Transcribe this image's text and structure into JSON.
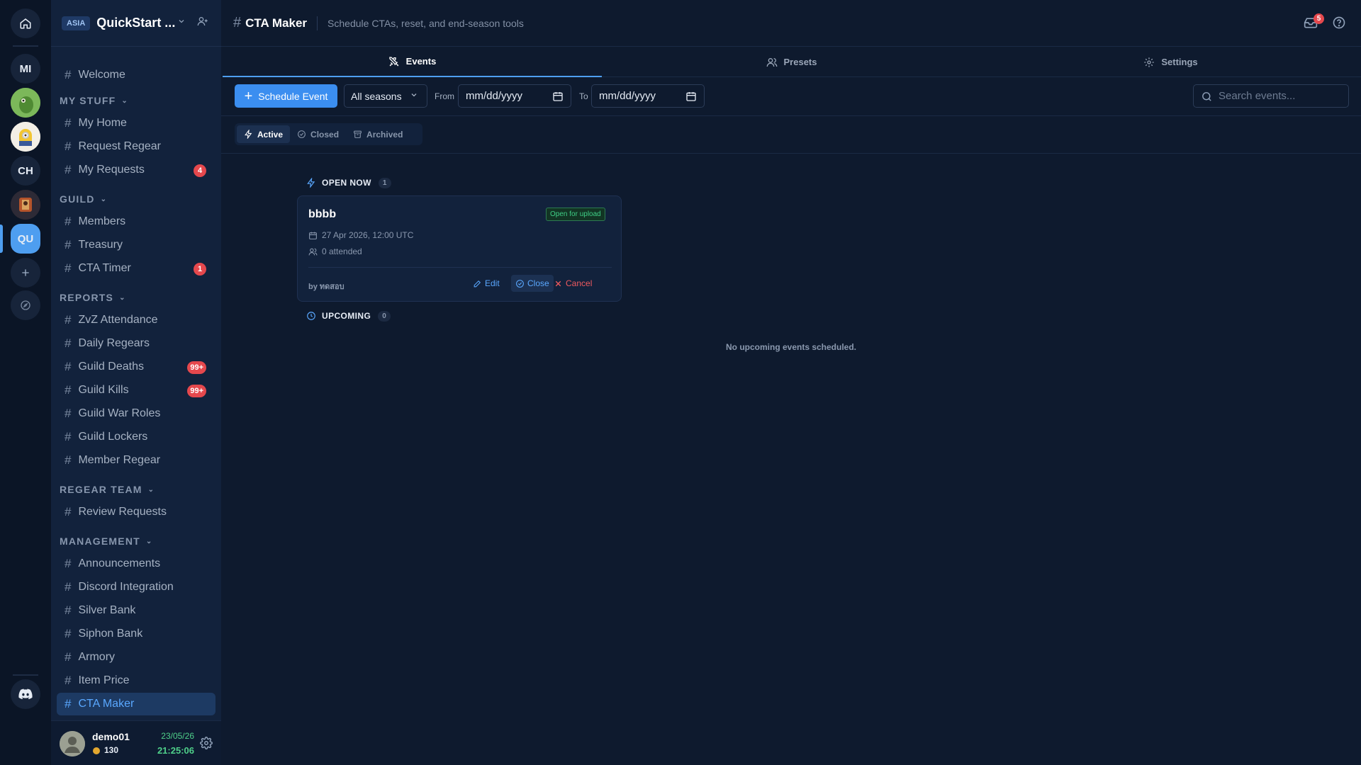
{
  "rail": {
    "items": [
      {
        "label": ""
      },
      {
        "label": "MI"
      },
      {
        "label": ""
      },
      {
        "label": ""
      },
      {
        "label": "CH"
      },
      {
        "label": ""
      },
      {
        "label": "QU"
      }
    ]
  },
  "server": {
    "region": "ASIA",
    "name": "QuickStart ..."
  },
  "sidebar": {
    "welcome": "Welcome",
    "categories": {
      "my_stuff": "MY STUFF",
      "guild": "GUILD",
      "reports": "REPORTS",
      "regear_team": "REGEAR TEAM",
      "management": "MANAGEMENT"
    },
    "my_stuff": [
      {
        "label": "My Home",
        "badge": ""
      },
      {
        "label": "Request Regear",
        "badge": ""
      },
      {
        "label": "My Requests",
        "badge": "4"
      }
    ],
    "guild": [
      {
        "label": "Members",
        "badge": ""
      },
      {
        "label": "Treasury",
        "badge": ""
      },
      {
        "label": "CTA Timer",
        "badge": "1"
      }
    ],
    "reports": [
      {
        "label": "ZvZ Attendance",
        "badge": ""
      },
      {
        "label": "Daily Regears",
        "badge": ""
      },
      {
        "label": "Guild Deaths",
        "badge": "99+"
      },
      {
        "label": "Guild Kills",
        "badge": "99+"
      },
      {
        "label": "Guild War Roles",
        "badge": ""
      },
      {
        "label": "Guild Lockers",
        "badge": ""
      },
      {
        "label": "Member Regear",
        "badge": ""
      }
    ],
    "regear_team": [
      {
        "label": "Review Requests",
        "badge": ""
      }
    ],
    "management": [
      {
        "label": "Announcements",
        "badge": ""
      },
      {
        "label": "Discord Integration",
        "badge": ""
      },
      {
        "label": "Silver Bank",
        "badge": ""
      },
      {
        "label": "Siphon Bank",
        "badge": ""
      },
      {
        "label": "Armory",
        "badge": ""
      },
      {
        "label": "Item Price",
        "badge": ""
      },
      {
        "label": "CTA Maker",
        "badge": ""
      }
    ]
  },
  "user": {
    "name": "demo01",
    "coins": "130",
    "date": "23/05/26",
    "time": "21:25:06"
  },
  "header": {
    "title": "CTA Maker",
    "subtitle": "Schedule CTAs, reset, and end-season tools",
    "inbox_count": "5"
  },
  "tabs": [
    {
      "label": "Events"
    },
    {
      "label": "Presets"
    },
    {
      "label": "Settings"
    }
  ],
  "toolbar": {
    "schedule_label": "Schedule Event",
    "season_select": "All seasons",
    "from_label": "From",
    "from_value": "mm/dd/yyyy",
    "to_label": "To",
    "to_value": "mm/dd/yyyy",
    "search_placeholder": "Search events..."
  },
  "filters": [
    {
      "label": "Active"
    },
    {
      "label": "Closed"
    },
    {
      "label": "Archived"
    }
  ],
  "sections": {
    "open_now": {
      "label": "OPEN NOW",
      "count": "1"
    },
    "upcoming": {
      "label": "UPCOMING",
      "count": "0",
      "empty": "No upcoming events scheduled."
    }
  },
  "event": {
    "title": "bbbb",
    "status": "Open for upload",
    "date": "27 Apr 2026, 12:00 UTC",
    "attended": "0 attended",
    "by": "by ทดสอบ",
    "edit": "Edit",
    "close": "Close",
    "cancel": "Cancel"
  },
  "colors": {
    "accent": "#3b8ef0",
    "badge": "#e5484d",
    "status_green": "#3fcf86",
    "cancel_red": "#ef5a5f"
  }
}
